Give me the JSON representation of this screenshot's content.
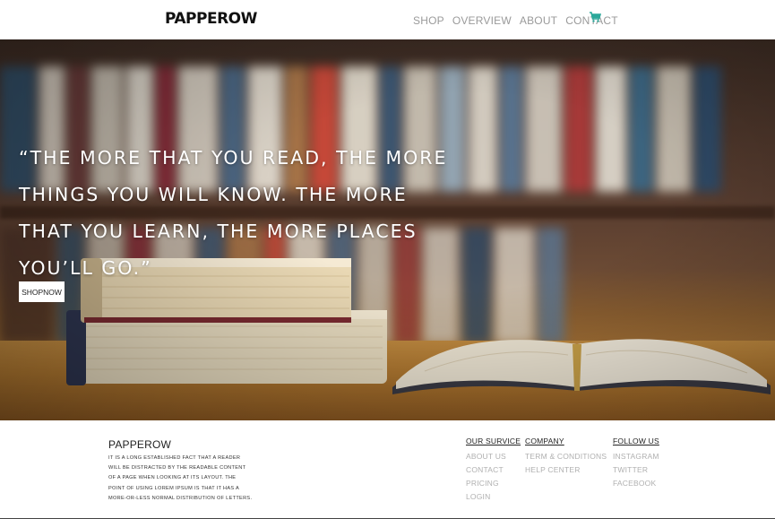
{
  "brand": "PAPPEROW",
  "nav": {
    "items": [
      "SHOP",
      "OVERVIEW",
      "ABOUT",
      "CONTACT"
    ],
    "cart_icon": "shopping-cart-icon",
    "cart_color": "#2aa89a"
  },
  "hero": {
    "quote": "“The more that you read, the more things you will know. The more that you learn, the more places you’ll go.”",
    "button_label": "SHOPNOW"
  },
  "footer": {
    "brand": "PAPPEROW",
    "description": "It is a long established fact that a reader will be distracted by the readable content of a page when looking at its layout. The point of using Lorem Ipsum is that it has a more-or-less normal distribution of letters.",
    "columns": [
      {
        "title": "OUR SURVICE",
        "links": [
          "ABOUT US",
          "CONTACT",
          "PRICING",
          "LOGIN"
        ]
      },
      {
        "title": "COMPANY",
        "links": [
          "TERM & CONDITIONS",
          "HELP CENTER"
        ]
      },
      {
        "title": "FOLLOW US",
        "links": [
          "INSTAGRAM",
          "TWITTER",
          "FACEBOOK"
        ]
      }
    ]
  }
}
